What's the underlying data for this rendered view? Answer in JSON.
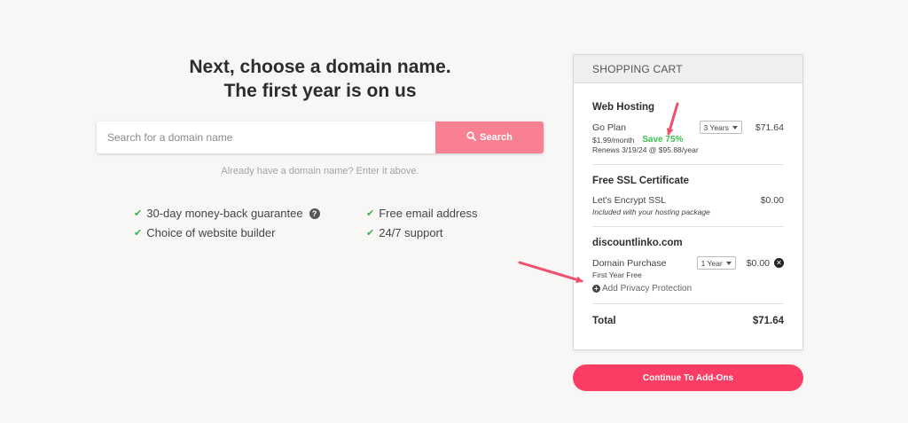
{
  "headline": {
    "line1": "Next, choose a domain name.",
    "line2": "The first year is on us"
  },
  "search": {
    "placeholder": "Search for a domain name",
    "value": "",
    "button_label": "Search",
    "button_icon": "search-icon",
    "hint": "Already have a domain name? Enter it above."
  },
  "features": [
    {
      "text": "30-day money-back guarantee",
      "icon": "check-icon",
      "help_icon": "?"
    },
    {
      "text": "Free email address",
      "icon": "check-icon"
    },
    {
      "text": "Choice of website builder",
      "icon": "check-icon"
    },
    {
      "text": "24/7 support",
      "icon": "check-icon"
    }
  ],
  "cart": {
    "header": "SHOPPING CART",
    "web_hosting": {
      "title": "Web Hosting",
      "plan": "Go Plan",
      "term": "3 Years",
      "price": "$71.64",
      "monthly": "$1.99/month",
      "save": "Save 75%",
      "renews": "Renews 3/19/24 @ $95.88/year"
    },
    "ssl": {
      "title": "Free SSL Certificate",
      "name": "Let's Encrypt SSL",
      "price": "$0.00",
      "note": "Included with your hosting package"
    },
    "domain": {
      "title": "discountlinko.com",
      "name": "Domain Purchase",
      "term": "1 Year",
      "price": "$0.00",
      "note": "First Year Free",
      "privacy": "Add Privacy Protection"
    },
    "total_label": "Total",
    "total_value": "$71.64"
  },
  "continue_label": "Continue To Add-Ons",
  "colors": {
    "accent": "#fb3c65",
    "search_button": "#f88092",
    "check": "#34b34f",
    "save": "#3cbf4f",
    "annotation_arrow": "#f0506e"
  }
}
